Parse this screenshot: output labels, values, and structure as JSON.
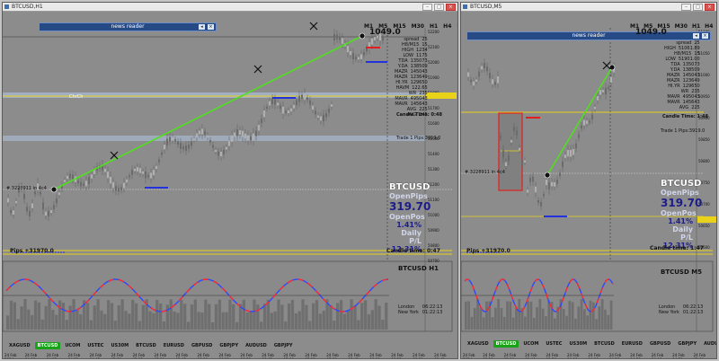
{
  "colors": {
    "bg": "#8c8c8c",
    "trend": "#4fe01e",
    "band": "#a7b6cf",
    "rsi_up": "#2b49ff",
    "rsi_down": "#ff2b2b",
    "symbar_active": "#18a218",
    "news": "#264a86",
    "yellow": "#e8d21a"
  },
  "left": {
    "title": "BTCUSD,H1",
    "timeframes": [
      "M1",
      "M5",
      "M15",
      "M30",
      "H1",
      "H4",
      "D1",
      "W1",
      "MN"
    ],
    "news_label": "news reader",
    "price": "1049.0",
    "info_rows": [
      [
        "spread",
        "25"
      ],
      [
        "H8/M15",
        "15"
      ],
      [
        "HIGH",
        "1234"
      ],
      [
        "LOW",
        "1175"
      ],
      [
        "TDA",
        "135073"
      ],
      [
        "Y.DA",
        "138509"
      ],
      [
        "MAZR",
        "145043"
      ],
      [
        "MAZR",
        "123649"
      ],
      [
        "HI.YR",
        "129650"
      ],
      [
        "HAVM",
        "122.65"
      ],
      [
        "WR",
        "235"
      ],
      [
        "MAVR",
        "495043"
      ],
      [
        "MAVR",
        "145643"
      ],
      [
        "AVG",
        "225"
      ],
      [
        "AVG",
        "245"
      ]
    ],
    "candle_time": "Candle Time:  0:48",
    "trade_label": "Trade 1 Pips:3919.0",
    "chrch": "ChrCh",
    "level_label": "#.3228911 in 4c4",
    "symbol": "BTCUSD",
    "open_pips_label": "OpenPips",
    "open_pips": "319.70",
    "open_pos_label": "OpenPos",
    "open_pos": "1.41%",
    "daily_label": "Daily P/L",
    "daily": "12.31%",
    "pips_total": "Pips +31970.0",
    "candle_time2": "Candle time:  0:47",
    "osc_label": "BTCUSD  H1",
    "sessions": [
      [
        "London",
        "06:22:13"
      ],
      [
        "New York",
        "01:22:13"
      ]
    ],
    "symbols": [
      "XAGUSD",
      "BTCUSD",
      "UCOM",
      "USTEC",
      "US30M",
      "BTCUSD",
      "EURUSD",
      "GBPUSD",
      "GBPJPY",
      "AUDUSD",
      "GBPJPY"
    ],
    "active_symbol_index": 1,
    "times": [
      "24 Feb 2024",
      "24 Feb 04:00",
      "24 Feb 04:15",
      "24 Feb 04:30",
      "24 Feb 04:45",
      "24 Feb 05:00",
      "24 Feb 05:15",
      "24 Feb 05:30",
      "24 Feb 05:45",
      "24 Feb 06:00",
      "24 Feb 06:15",
      "24 Feb 06:30",
      "24 Feb 06:45",
      "24 Feb 07:00",
      "24 Feb 07:15",
      "24 Feb 07:30",
      "24 Feb 07:45",
      "24 Feb 08:00",
      "24 Feb 08:15",
      "24 Feb 08:30",
      "24 Feb 08:45"
    ],
    "scale": [
      "52200",
      "52100",
      "52000",
      "51900",
      "51800",
      "51700",
      "51600",
      "51500",
      "51400",
      "51300",
      "51200",
      "51100",
      "51000",
      "50900",
      "50800",
      "50700"
    ]
  },
  "right": {
    "title": "BTCUSD,M5",
    "timeframes": [
      "M1",
      "M5",
      "M15",
      "M30",
      "H1",
      "H4",
      "D1",
      "W1",
      "MN"
    ],
    "news_label": "news reader",
    "price": "1049.0",
    "info_rows": [
      [
        "spread",
        "25"
      ],
      [
        "HIGH",
        "51061.89"
      ],
      [
        "H8/M15",
        "15"
      ],
      [
        "LOW",
        "51901.00"
      ],
      [
        "TDA",
        "135073"
      ],
      [
        "Y.DA",
        "138509"
      ],
      [
        "MAZR",
        "145043"
      ],
      [
        "MAZR",
        "123649"
      ],
      [
        "HI.YR",
        "129650"
      ],
      [
        "WR",
        "235"
      ],
      [
        "MAVR",
        "495043"
      ],
      [
        "MAVR",
        "145643"
      ],
      [
        "AVG",
        "225"
      ]
    ],
    "candle_time": "Candle Time:  1:48",
    "trade_label": "Trade 1 Pips:3919.0",
    "level_label": "#.3228911 in 4c4",
    "symbol": "BTCUSD",
    "open_pips_label": "OpenPips",
    "open_pips": "319.70",
    "open_pos_label": "OpenPos",
    "open_pos": "1.41%",
    "daily_label": "Daily P/L",
    "daily": "12.31%",
    "pips_total": "Pips +31970.0",
    "candle_time2": "Candle time:  1:47",
    "osc_label": "BTCUSD  M5",
    "sessions": [
      [
        "London",
        "06:22:13"
      ],
      [
        "New York",
        "01:22:13"
      ]
    ],
    "symbols": [
      "XAGUSD",
      "BTCUSD",
      "UCOM",
      "USTEC",
      "US30M",
      "BTCUSD",
      "EURUSD",
      "GBPUSD",
      "GBPJPY",
      "AUDUSD",
      "GBPJPY"
    ],
    "active_symbol_index": 1,
    "times": [
      "24 Feb 2024",
      "24 Feb 03:20",
      "24 Feb 03:30",
      "24 Feb 03:40",
      "24 Feb 03:50",
      "24 Feb 04:00",
      "24 Feb 04:10",
      "24 Feb 04:20",
      "24 Feb 04:30",
      "24 Feb 04:40",
      "24 Feb 04:50",
      "24 Feb 05:00"
    ],
    "scale": [
      "51100",
      "51050",
      "51000",
      "50950",
      "50900",
      "50850",
      "50800",
      "50750",
      "50700",
      "50650",
      "50600"
    ]
  }
}
